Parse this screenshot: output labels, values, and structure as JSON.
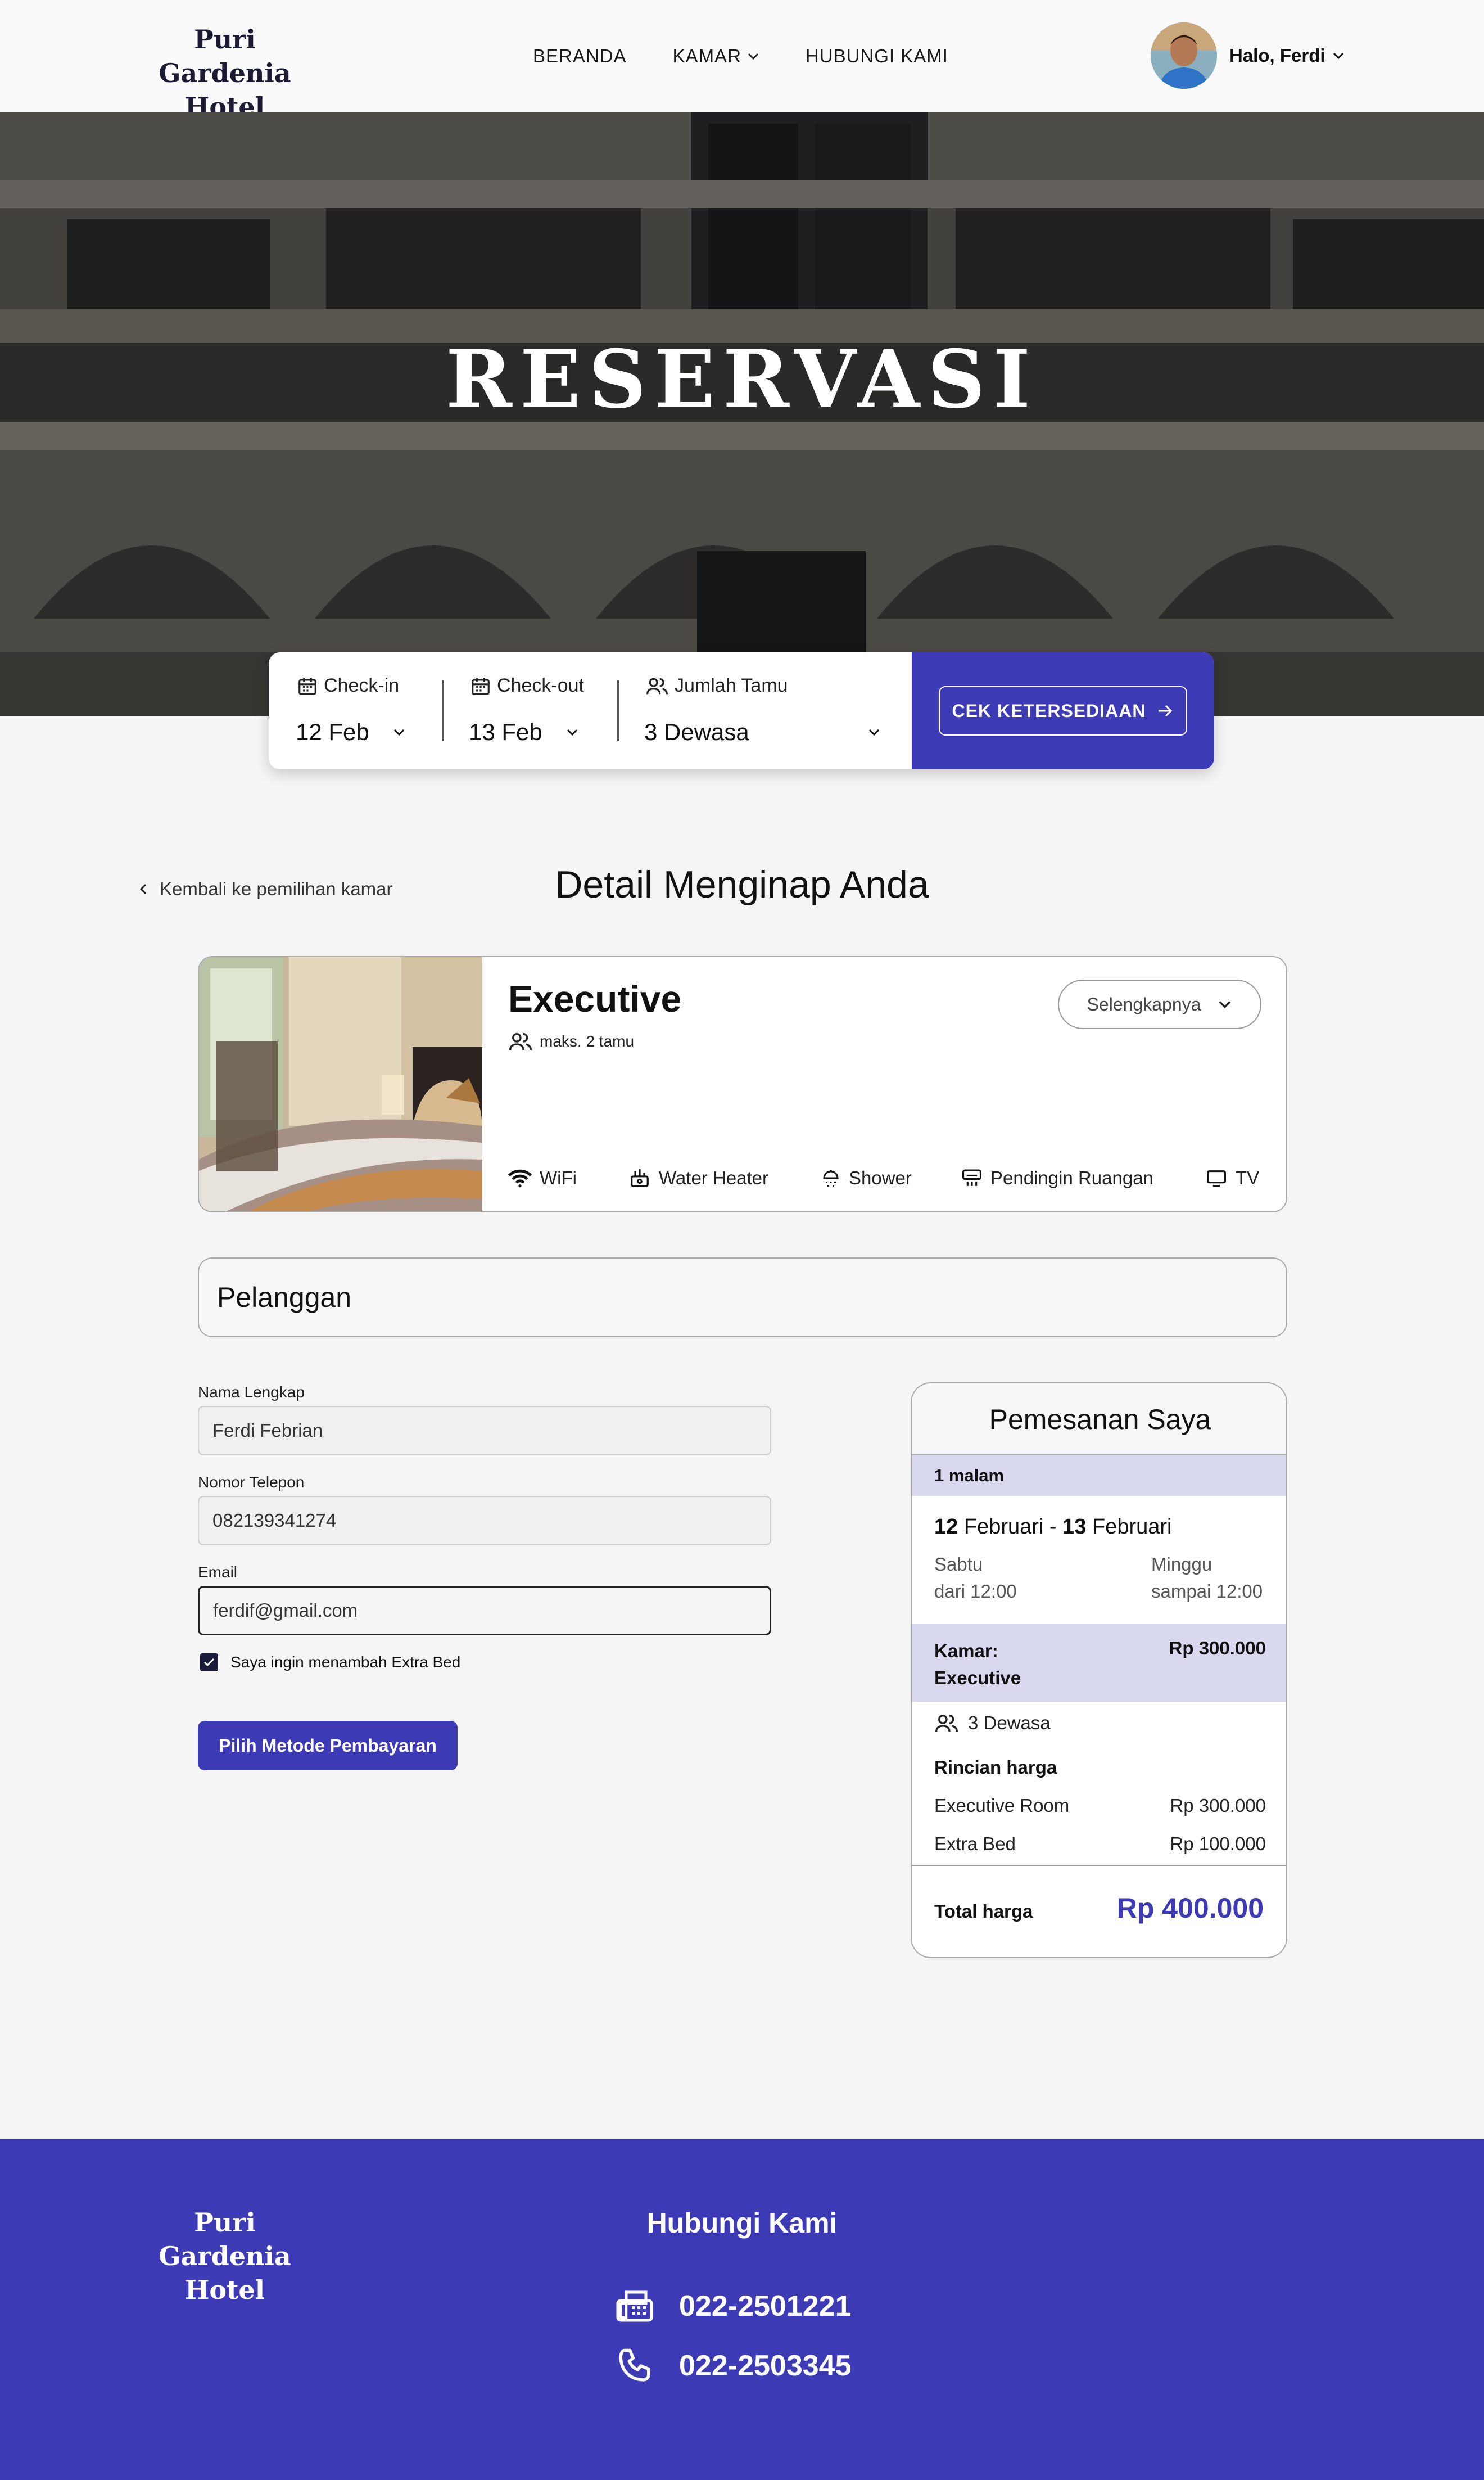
{
  "nav": {
    "logo_line1": "Puri Gardenia",
    "logo_line2": "Hotel",
    "links": [
      "BERANDA",
      "KAMAR",
      "HUBUNGI KAMI"
    ],
    "user_greeting": "Halo, Ferdi"
  },
  "hero": {
    "title": "RESERVASI"
  },
  "booking": {
    "checkin_label": "Check-in",
    "checkin_value": "12 Feb",
    "checkout_label": "Check-out",
    "checkout_value": "13 Feb",
    "guests_label": "Jumlah Tamu",
    "guests_value": "3 Dewasa",
    "button_label": "CEK KETERSEDIAAN"
  },
  "detail": {
    "back_label": "Kembali ke pemilihan kamar",
    "title": "Detail Menginap Anda"
  },
  "room": {
    "name": "Executive",
    "capacity": "maks. 2 tamu",
    "more_label": "Selengkapnya",
    "amenities": [
      "WiFi",
      "Water Heater",
      "Shower",
      "Pendingin Ruangan",
      "TV"
    ]
  },
  "customer": {
    "section_title": "Pelanggan",
    "name_label": "Nama Lengkap",
    "name_value": "Ferdi Febrian",
    "phone_label": "Nomor Telepon",
    "phone_value": "082139341274",
    "email_label": "Email",
    "email_value": "ferdif@gmail.com",
    "extra_bed_label": "Saya ingin menambah Extra Bed",
    "extra_bed_checked": true,
    "pay_button": "Pilih Metode Pembayaran"
  },
  "summary": {
    "title": "Pemesanan Saya",
    "nights": "1 malam",
    "checkin_day_num": "12",
    "checkin_month": "Februari",
    "separator": "-",
    "checkout_day_num": "13",
    "checkout_month": "Februari",
    "checkin_weekday": "Sabtu",
    "checkin_time": "dari 12:00",
    "checkout_weekday": "Minggu",
    "checkout_time": "sampai 12:00",
    "room_label_line1": "Kamar:",
    "room_label_line2": "Executive",
    "room_price": "Rp 300.000",
    "guests": "3 Dewasa",
    "breakdown_title": "Rincian harga",
    "items": [
      {
        "label": "Executive Room",
        "price": "Rp 300.000"
      },
      {
        "label": "Extra Bed",
        "price": "Rp 100.000"
      }
    ],
    "total_label": "Total harga",
    "total_value": "Rp 400.000"
  },
  "footer": {
    "logo_line1": "Puri Gardenia",
    "logo_line2": "Hotel",
    "contact_title": "Hubungi Kami",
    "fax": "022-2501221",
    "phone": "022-2503345"
  },
  "colors": {
    "accent": "#3c3ab5",
    "accent_light": "#d8d8ef",
    "navy_text": "#1b1b35"
  }
}
